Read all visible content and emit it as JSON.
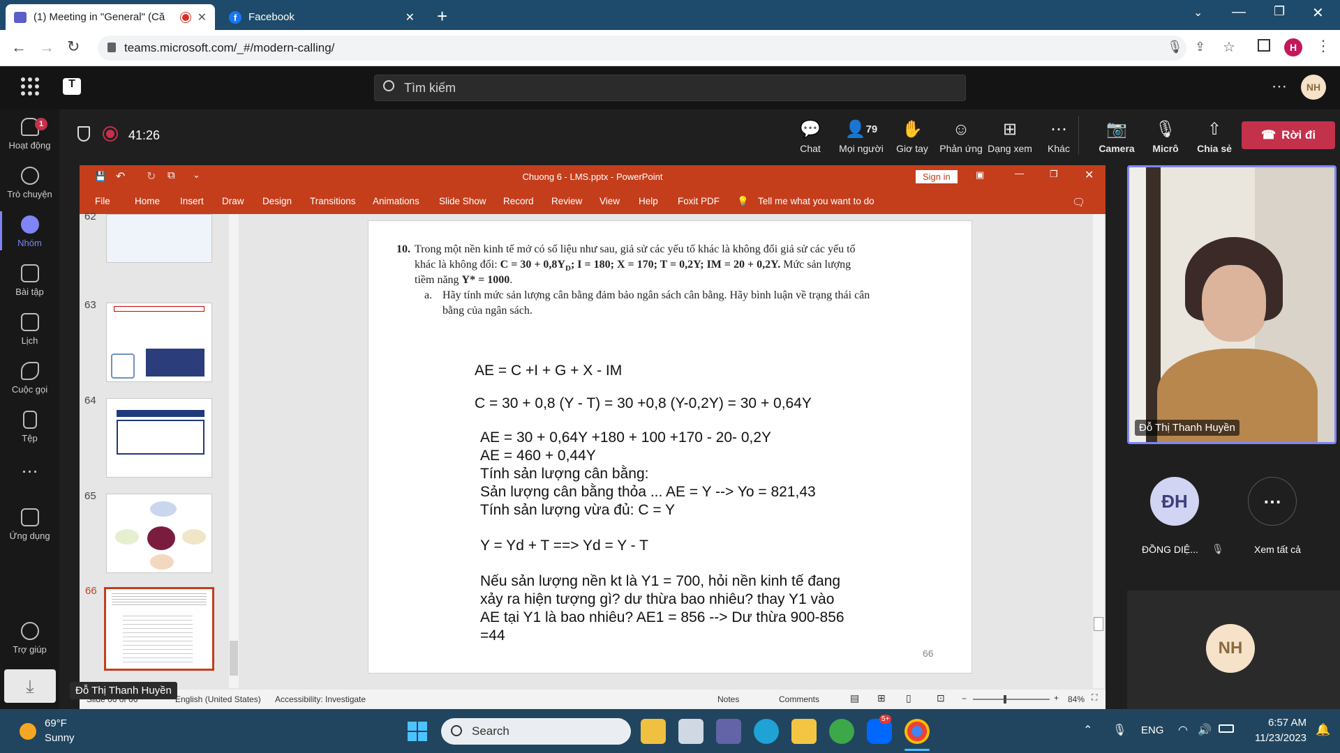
{
  "browser": {
    "tabs": [
      {
        "label": "(1) Meeting in \"General\" (Că",
        "icon": "teams-icon"
      },
      {
        "label": "Facebook",
        "icon": "facebook-icon"
      }
    ],
    "url": "teams.microsoft.com/_#/modern-calling/",
    "profile_initial": "H"
  },
  "teams": {
    "search_placeholder": "Tìm kiếm",
    "user_initials": "NH",
    "rail": [
      {
        "label": "Hoạt động",
        "badge": "1"
      },
      {
        "label": "Trò chuyện"
      },
      {
        "label": "Nhóm"
      },
      {
        "label": "Bài tập"
      },
      {
        "label": "Lịch"
      },
      {
        "label": "Cuộc gọi"
      },
      {
        "label": "Tệp"
      },
      {
        "label": "Ứng dụng"
      },
      {
        "label": "Trợ giúp"
      }
    ],
    "meeting_timer": "41:26",
    "controls": {
      "chat": "Chat",
      "people": "Mọi người",
      "people_count": "79",
      "raise_hand": "Giơ tay",
      "react": "Phản ứng",
      "view": "Dạng xem",
      "more": "Khác",
      "camera": "Camera",
      "mic": "Micrô",
      "share": "Chia sẻ",
      "leave": "Rời đi"
    },
    "presenter_tag": "Đỗ Thị Thanh Huyền",
    "participants": {
      "video_name": "Đỗ Thị Thanh Huyền",
      "p1_initials": "ĐH",
      "p1_name": "ĐỒNG DIỆ...",
      "see_all": "Xem tất cả",
      "p2_initials": "NH"
    }
  },
  "powerpoint": {
    "title": "Chuong 6 - LMS.pptx  -  PowerPoint",
    "sign_in": "Sign in",
    "menu": [
      "File",
      "Home",
      "Insert",
      "Draw",
      "Design",
      "Transitions",
      "Animations",
      "Slide Show",
      "Record",
      "Review",
      "View",
      "Help",
      "Foxit PDF"
    ],
    "tell_me": "Tell me what you want to do",
    "thumbnails": [
      "62",
      "63",
      "64",
      "65",
      "66"
    ],
    "status": {
      "slide": "Slide 66 of 66",
      "language": "English (United States)",
      "accessibility": "Accessibility: Investigate",
      "notes": "Notes",
      "comments": "Comments",
      "zoom": "84%"
    },
    "slide": {
      "number": "66",
      "problem_num": "10.",
      "problem_line1": "Trong một nền kinh tế mở có số liệu như sau, giả sử các yếu tố khác là không đổi giả sử các yếu tố",
      "problem_line2a": "khác là không đổi: ",
      "problem_line2b": "C = 30 + 0,8Y",
      "problem_line2sub": "D",
      "problem_line2c": "; I = 180; X = 170;   T = 0,2Y; IM = 20 + 0,2Y.",
      "problem_line2d": " Mức sản lượng",
      "problem_line3a": "tiềm năng ",
      "problem_line3b": "Y* = 1000",
      "problem_line3c": ".",
      "sub_a_label": "a.",
      "sub_a_line1": "Hãy tính mức sản lượng cân bằng đảm bảo ngân sách cân bằng. Hãy bình luận về trạng thái cân",
      "sub_a_line2": "bằng của ngân sách.",
      "eq1": "AE = C +I + G + X - IM",
      "eq2": "C = 30 + 0,8 (Y - T) = 30 +0,8 (Y-0,2Y) = 30 + 0,64Y",
      "eq3": "AE = 30 + 0,64Y +180 + 100 +170 - 20- 0,2Y",
      "eq4": "AE = 460 + 0,44Y",
      "eq5": "Tính sản lượng cân bằng:",
      "eq6": "Sản lượng cân bằng thỏa ... AE = Y --> Yo = 821,43",
      "eq7": "Tính sản lượng vừa đủ: C = Y",
      "eq8": "Y = Yd + T ==> Yd = Y - T",
      "eq9": "Nếu sản lượng nền kt là Y1 = 700, hỏi nền kinh tế đang",
      "eq10": "xảy ra hiện tượng gì? dư thừa bao nhiêu? thay Y1 vào",
      "eq11": "AE tại Y1 là bao nhiêu? AE1 = 856 --> Dư thừa 900-856",
      "eq12": "=44"
    }
  },
  "taskbar": {
    "temp": "69°F",
    "weather": "Sunny",
    "search": "Search",
    "lang": "ENG",
    "time": "6:57 AM",
    "date": "11/23/2023",
    "zalo_badge": "5+"
  }
}
